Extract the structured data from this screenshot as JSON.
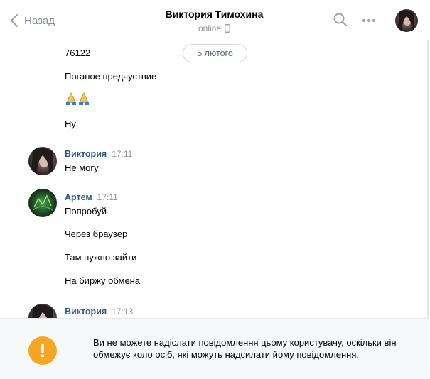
{
  "header": {
    "back_label": "Назад",
    "title": "Виктория Тимохина",
    "status": "online"
  },
  "date_divider": "5 лютого",
  "messages": [
    {
      "text": "76122"
    },
    {
      "text": "Поганое предчуствие"
    },
    {
      "text": "Ну"
    }
  ],
  "groups": [
    {
      "author": "Виктория",
      "time": "17:11",
      "lines": [
        "Не могу"
      ]
    },
    {
      "author": "Артем",
      "time": "17:11",
      "lines": [
        "Попробуй",
        "Через браузер",
        "Там нужно зайти",
        "На биржу обмена"
      ]
    },
    {
      "author": "Виктория",
      "time": "17:13"
    }
  ],
  "notice": {
    "icon": "!",
    "text": "Ви не можете надіслати повідомлення цьому користувачу, оскільки він обмежує коло осіб, які можуть надсилати йому повідомлення."
  },
  "colors": {
    "link": "#2a5885",
    "muted": "#939393",
    "warning": "#f6a623"
  }
}
